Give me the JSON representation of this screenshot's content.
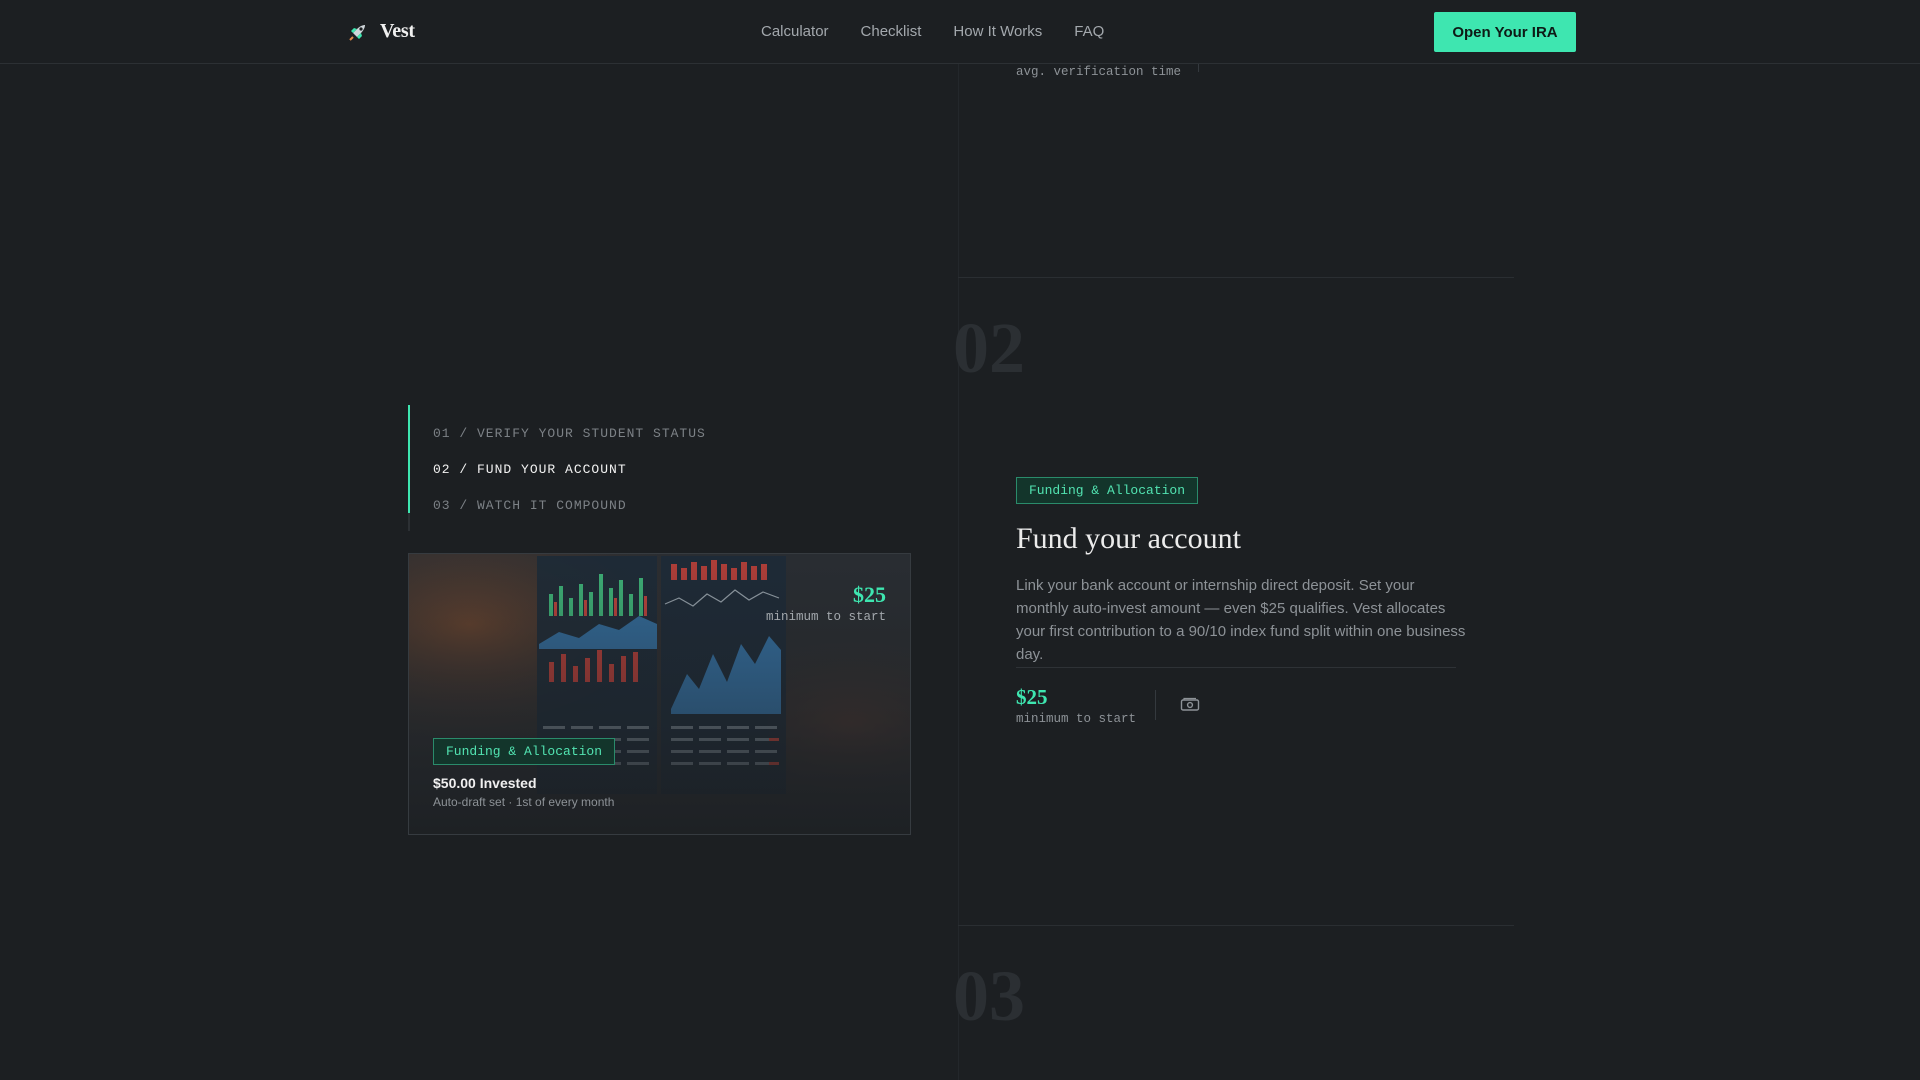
{
  "nav": {
    "brand": "Vest",
    "links": [
      "Calculator",
      "Checklist",
      "How It Works",
      "FAQ"
    ],
    "cta": "Open Your IRA"
  },
  "previous_step": {
    "stat_label": "avg. verification time"
  },
  "step_numbers": [
    "02",
    "03"
  ],
  "progress": {
    "items": [
      "01 / VERIFY YOUR STUDENT STATUS",
      "02 / FUND YOUR ACCOUNT",
      "03 / WATCH IT COMPOUND"
    ],
    "active_index": 1,
    "fill_fraction": 0.86
  },
  "card": {
    "value": "$25",
    "value_label": "minimum to start",
    "tag": "Funding & Allocation",
    "amount": "$50.00 Invested",
    "sub": "Auto-draft set · 1st of every month"
  },
  "step": {
    "tag": "Funding & Allocation",
    "title": "Fund your account",
    "description": "Link your bank account or internship direct deposit. Set your monthly auto-invest amount — even $25 qualifies. Vest allocates your first contribution to a 90/10 index fund split within one business day.",
    "stat_value": "$25",
    "stat_label": "minimum to start",
    "stat_icon": "cash-icon"
  },
  "colors": {
    "accent": "#3ee6b0",
    "background": "#1c1f22",
    "tag_background": "#13352b"
  }
}
